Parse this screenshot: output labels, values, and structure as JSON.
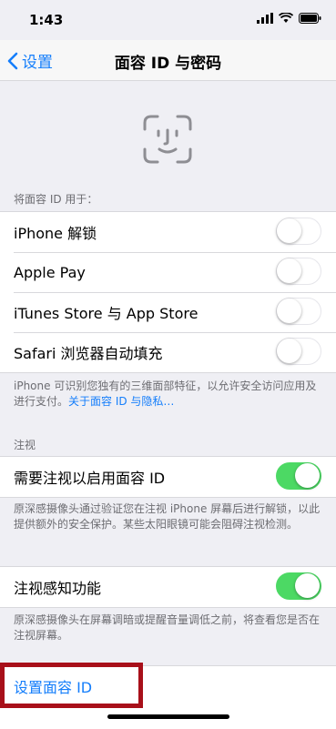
{
  "status": {
    "time": "1:43"
  },
  "nav": {
    "back_label": "设置",
    "title": "面容 ID 与密码"
  },
  "use_for": {
    "header": "将面容 ID 用于：",
    "rows": [
      {
        "label": "iPhone 解锁",
        "on": false
      },
      {
        "label": "Apple Pay",
        "on": false
      },
      {
        "label": "iTunes Store 与 App Store",
        "on": false
      },
      {
        "label": "Safari 浏览器自动填充",
        "on": false
      }
    ],
    "footer_text": "iPhone 可识别您独有的三维面部特征，以允许安全访问应用及进行支付。",
    "footer_link": "关于面容 ID 与隐私…"
  },
  "attention": {
    "header": "注视",
    "require_label": "需要注视以启用面容 ID",
    "require_on": true,
    "require_footer": "原深感摄像头通过验证您在注视 iPhone 屏幕后进行解锁，以此提供额外的安全保护。某些太阳眼镜可能会阻碍注视检测。",
    "aware_label": "注视感知功能",
    "aware_on": true,
    "aware_footer": "原深感摄像头在屏幕调暗或提醒音量调低之前，将查看您是否在注视屏幕。"
  },
  "setup": {
    "label": "设置面容 ID"
  },
  "colors": {
    "accent": "#147efb",
    "toggle_on": "#4cd964",
    "highlight": "#a8101a"
  }
}
